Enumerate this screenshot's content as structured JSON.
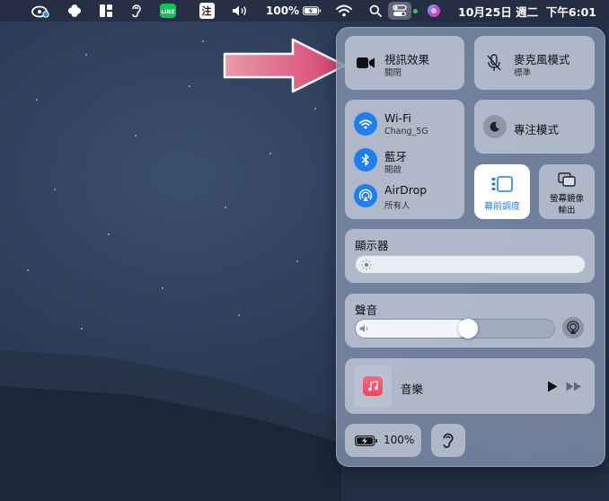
{
  "menubar": {
    "input_method": "注",
    "battery": "100%",
    "datetime": "10月25日 週二  下午6:01"
  },
  "control_center": {
    "video_effects": {
      "title": "視訊效果",
      "status": "關閉"
    },
    "mic_mode": {
      "title": "麥克風模式",
      "status": "標準"
    },
    "wifi": {
      "title": "Wi-Fi",
      "network": "Chang_5G"
    },
    "bluetooth": {
      "title": "藍牙",
      "status": "開啟"
    },
    "airdrop": {
      "title": "AirDrop",
      "status": "所有人"
    },
    "focus": {
      "title": "專注模式"
    },
    "stage_manager": {
      "title": "幕前調度"
    },
    "screen_mirroring": {
      "line1": "螢幕鏡像",
      "line2": "輸出"
    },
    "display": {
      "title": "顯示器",
      "level": 0.0
    },
    "sound": {
      "title": "聲音",
      "level": 0.55
    },
    "now_playing": {
      "app": "音樂"
    },
    "battery": {
      "label": "100%"
    }
  },
  "colors": {
    "accent_blue": "#1f7ef0",
    "arrow_pink": "#d6406f",
    "music_red": "#f2445e"
  }
}
